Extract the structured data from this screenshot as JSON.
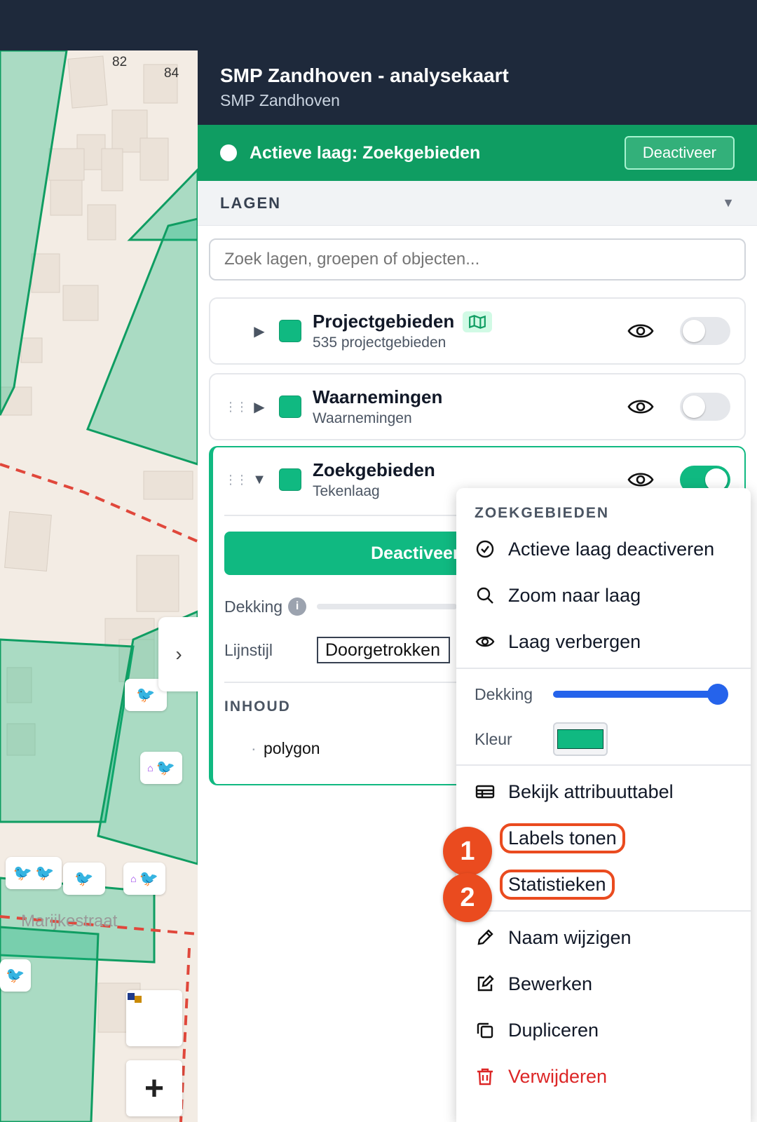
{
  "map": {
    "house_numbers": [
      "82",
      "84"
    ],
    "street": "Marijkestraat"
  },
  "panel": {
    "title": "SMP Zandhoven - analysekaart",
    "subtitle": "SMP Zandhoven",
    "active_layer": {
      "label": "Actieve laag: Zoekgebieden",
      "button": "Deactiveer"
    },
    "lagen_title": "LAGEN",
    "search_placeholder": "Zoek lagen, groepen of objecten...",
    "layers": [
      {
        "name": "Projectgebieden",
        "sub": "535 projectgebieden",
        "visible_toggle": false,
        "color": "#10b981"
      },
      {
        "name": "Waarnemingen",
        "sub": "Waarnemingen",
        "visible_toggle": false,
        "color": "#10b981"
      },
      {
        "name": "Zoekgebieden",
        "sub": "Tekenlaag",
        "visible_toggle": true,
        "color": "#10b981"
      }
    ],
    "expanded": {
      "button": "Deactiveer t",
      "dekking_label": "Dekking",
      "lijnstijl_label": "Lijnstijl",
      "lijnstijl_value": "Doorgetrokken",
      "inhoud_title": "INHOUD",
      "items": [
        "polygon"
      ]
    }
  },
  "menu": {
    "header": "ZOEKGEBIEDEN",
    "items_top": [
      {
        "label": "Actieve laag deactiveren",
        "icon": "check-circle-icon"
      },
      {
        "label": "Zoom naar laag",
        "icon": "search-icon"
      },
      {
        "label": "Laag verbergen",
        "icon": "eye-icon"
      }
    ],
    "dekking_label": "Dekking",
    "dekking_value": 1.0,
    "kleur_label": "Kleur",
    "kleur_value": "#10b981",
    "items_mid": [
      {
        "label": "Bekijk attribuuttabel",
        "icon": "table-icon"
      },
      {
        "label": "Labels tonen",
        "badge": "1"
      },
      {
        "label": "Statistieken",
        "badge": "2"
      }
    ],
    "items_bottom": [
      {
        "label": "Naam wijzigen",
        "icon": "pencil-icon"
      },
      {
        "label": "Bewerken",
        "icon": "edit-icon"
      },
      {
        "label": "Dupliceren",
        "icon": "copy-icon"
      },
      {
        "label": "Verwijderen",
        "icon": "trash-icon"
      }
    ]
  },
  "colors": {
    "accent": "#10b981",
    "header": "#1e293b",
    "highlight": "#ea4b1f",
    "danger": "#dc2626"
  }
}
